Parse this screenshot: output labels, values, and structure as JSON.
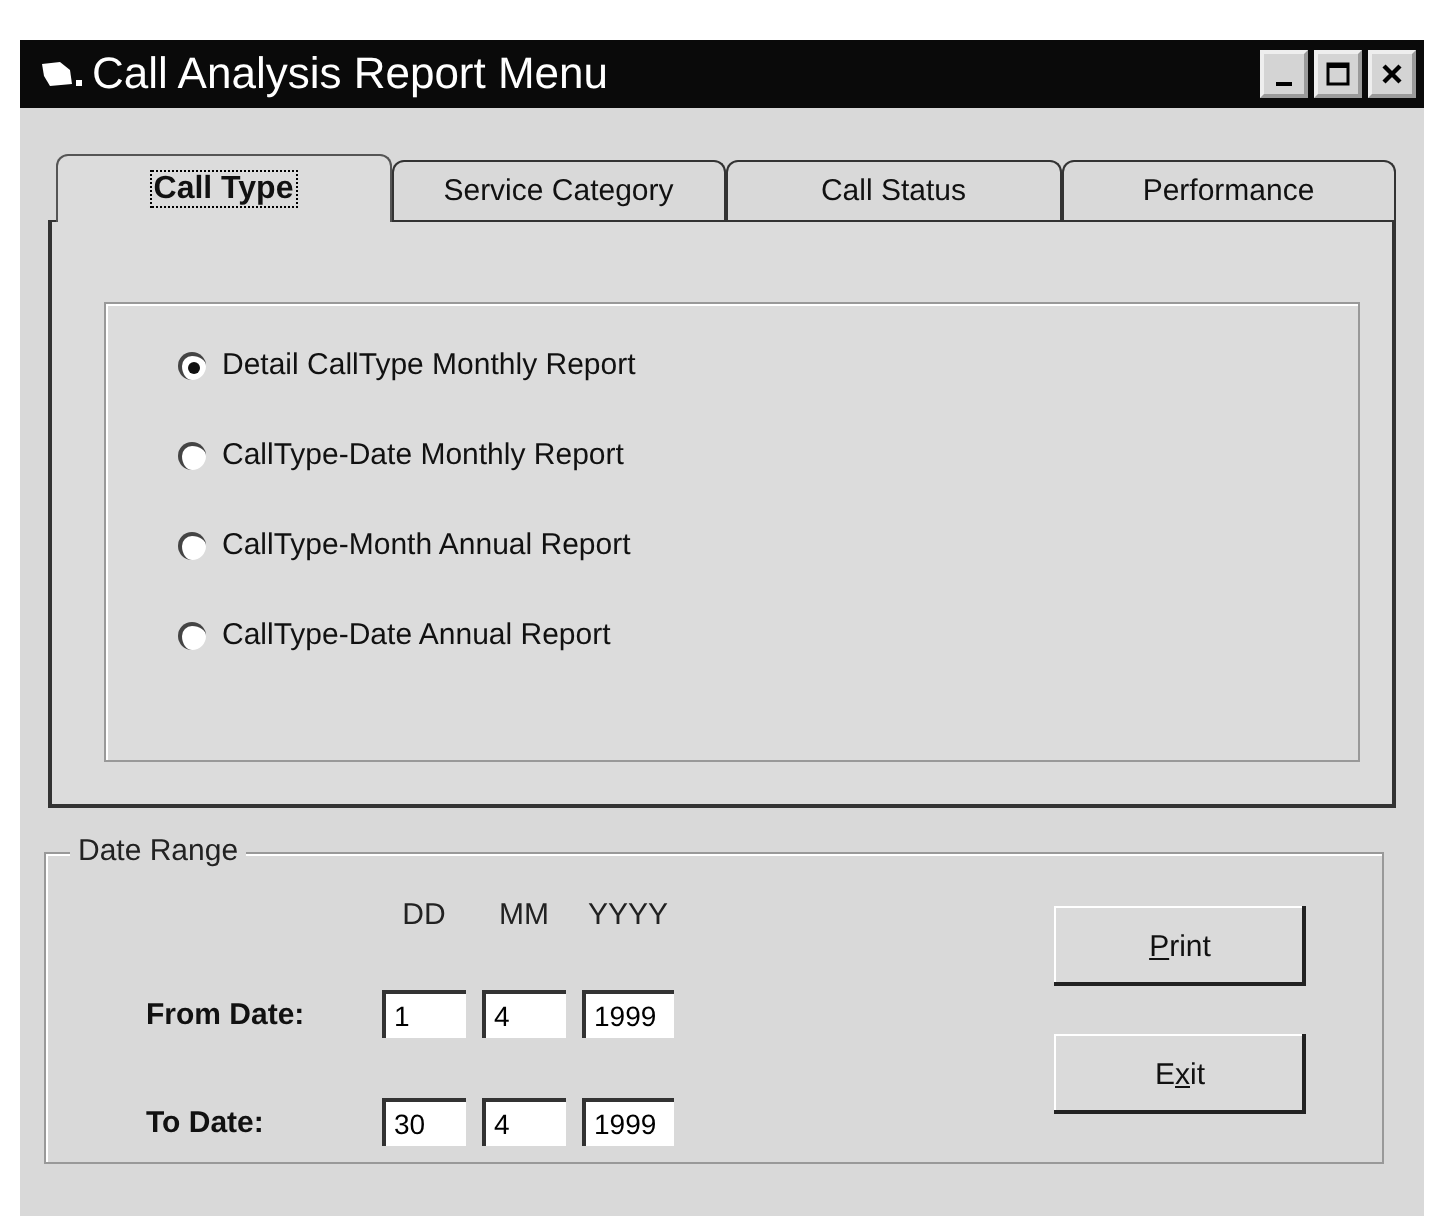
{
  "window": {
    "title": "Call Analysis Report Menu"
  },
  "tabs": [
    {
      "label": "Call Type",
      "selected": true
    },
    {
      "label": "Service Category",
      "selected": false
    },
    {
      "label": "Call Status",
      "selected": false
    },
    {
      "label": "Performance",
      "selected": false
    }
  ],
  "report_options": [
    {
      "label": "Detail CallType Monthly Report",
      "selected": true
    },
    {
      "label": "CallType-Date Monthly Report",
      "selected": false
    },
    {
      "label": "CallType-Month Annual Report",
      "selected": false
    },
    {
      "label": "CallType-Date Annual Report",
      "selected": false
    }
  ],
  "date_range": {
    "title": "Date Range",
    "columns": [
      "DD",
      "MM",
      "YYYY"
    ],
    "rows": [
      {
        "label": "From Date:",
        "values": [
          "1",
          "4",
          "1999"
        ]
      },
      {
        "label": "To Date:",
        "values": [
          "30",
          "4",
          "1999"
        ]
      }
    ]
  },
  "buttons": [
    {
      "key": "P",
      "after": "rint"
    },
    {
      "before": "E",
      "key": "x",
      "after": "it"
    }
  ]
}
